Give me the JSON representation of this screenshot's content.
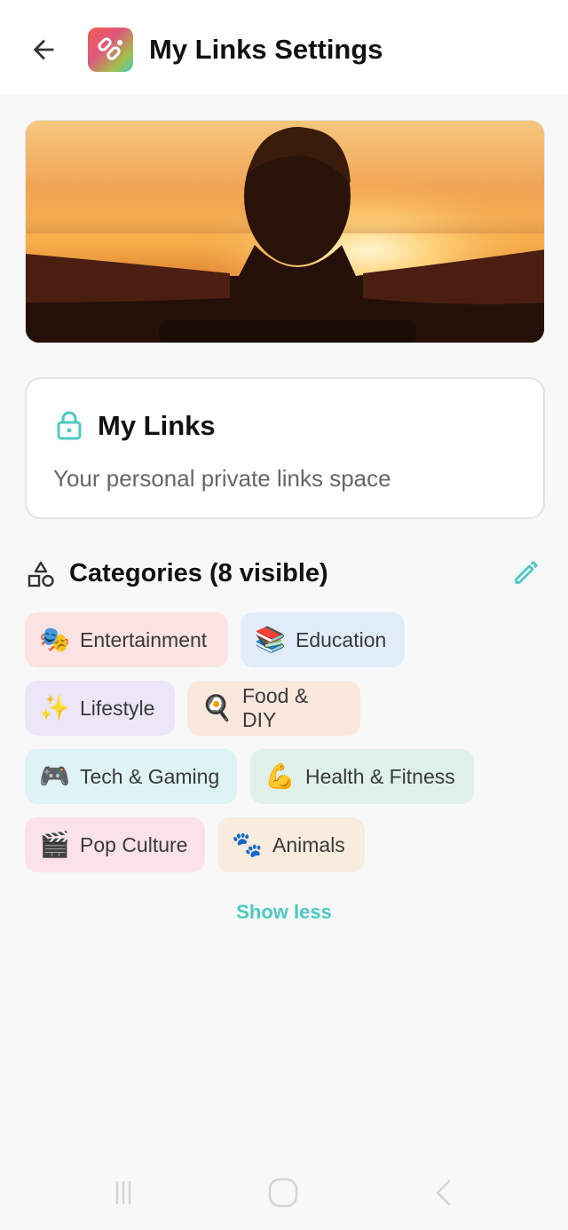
{
  "header": {
    "title": "My Links Settings"
  },
  "banner": {
    "alt_subject": "person with outstretched arms facing sunset"
  },
  "profile": {
    "name": "My Links",
    "description": "Your personal private links space"
  },
  "categories": {
    "title": "Categories (8 visible)",
    "items": [
      {
        "emoji": "🎭",
        "label": "Entertainment",
        "color": "#fbe3e3"
      },
      {
        "emoji": "📚",
        "label": "Education",
        "color": "#e1ecfb"
      },
      {
        "emoji": "✨",
        "label": "Lifestyle",
        "color": "#ebe6f8"
      },
      {
        "emoji": "🍳",
        "label": "Food & DIY",
        "color": "#fbe8dd"
      },
      {
        "emoji": "🎮",
        "label": "Tech & Gaming",
        "color": "#def3f4"
      },
      {
        "emoji": "💪",
        "label": "Health & Fitness",
        "color": "#dff1ea"
      },
      {
        "emoji": "🎬",
        "label": "Pop Culture",
        "color": "#fbe2ea"
      },
      {
        "emoji": "🐾",
        "label": "Animals",
        "color": "#f7ecde"
      }
    ],
    "toggle_label": "Show less"
  },
  "colors": {
    "accent": "#4ec9c2",
    "background": "#f8f8f8"
  }
}
